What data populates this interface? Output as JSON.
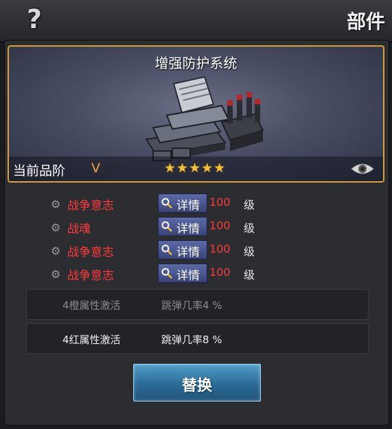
{
  "header": {
    "help_label": "?",
    "title": "部件"
  },
  "part": {
    "name": "增强防护系统",
    "rank_label": "当前品阶",
    "rank_value": "V",
    "stars": "★★★★★",
    "star_count": 5
  },
  "attributes": [
    {
      "name": "战争意志",
      "detail_label": "详情",
      "level": "100",
      "level_unit": "级"
    },
    {
      "name": "战魂",
      "detail_label": "详情",
      "level": "100",
      "level_unit": "级"
    },
    {
      "name": "战争意志",
      "detail_label": "详情",
      "level": "100",
      "level_unit": "级"
    },
    {
      "name": "战争意志",
      "detail_label": "详情",
      "level": "100",
      "level_unit": "级"
    }
  ],
  "bonuses": [
    {
      "name": "4橙属性激活",
      "value": "跳弹几率4 %",
      "active": false
    },
    {
      "name": "4红属性激活",
      "value": "跳弹几率8 %",
      "active": true
    }
  ],
  "replace_button": "替换",
  "colors": {
    "accent_border": "#d9a23b",
    "attr_red": "#ff3a3a",
    "rank_orange": "#f2a23a",
    "button_blue": "#2b6c97"
  }
}
